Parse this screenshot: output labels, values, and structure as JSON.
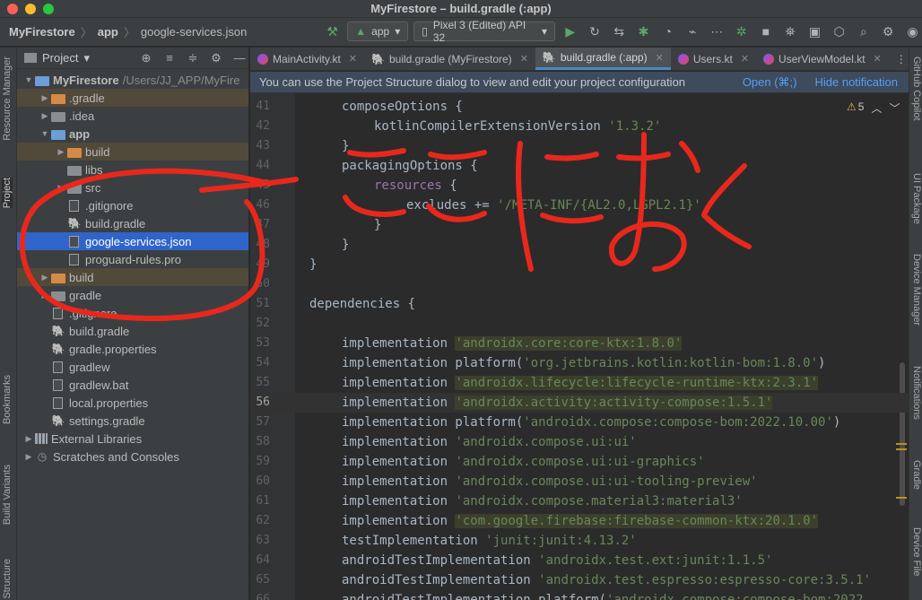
{
  "window": {
    "title": "MyFirestore – build.gradle (:app)"
  },
  "toolbar": {
    "breadcrumb": [
      "MyFirestore",
      "app",
      "google-services.json"
    ],
    "run_config": "app",
    "device": "Pixel 3 (Edited) API 32"
  },
  "left_strip": [
    "Resource Manager",
    "Project",
    "Bookmarks",
    "Build Variants",
    "Structure"
  ],
  "right_strip": [
    "GitHub Copilot",
    "UI Package",
    "Device Manager",
    "Notifications",
    "Gradle",
    "Device File"
  ],
  "project": {
    "header": "Project",
    "tree": [
      {
        "label": "MyFirestore",
        "path": "/Users/JJ_APP/MyFire",
        "level": 0,
        "arrow": "down",
        "icon": "folder-blue",
        "bold": true
      },
      {
        "label": ".gradle",
        "level": 1,
        "arrow": "right",
        "icon": "folder-orange",
        "excluded": true
      },
      {
        "label": ".idea",
        "level": 1,
        "arrow": "right",
        "icon": "folder"
      },
      {
        "label": "app",
        "level": 1,
        "arrow": "down",
        "icon": "folder-blue",
        "bold": true
      },
      {
        "label": "build",
        "level": 2,
        "arrow": "right",
        "icon": "folder-orange",
        "excluded": true
      },
      {
        "label": "libs",
        "level": 2,
        "arrow": "",
        "icon": "folder"
      },
      {
        "label": "src",
        "level": 2,
        "arrow": "right",
        "icon": "folder"
      },
      {
        "label": ".gitignore",
        "level": 2,
        "arrow": "",
        "icon": "file"
      },
      {
        "label": "build.gradle",
        "level": 2,
        "arrow": "",
        "icon": "gradle"
      },
      {
        "label": "google-services.json",
        "level": 2,
        "arrow": "",
        "icon": "file",
        "selected": true
      },
      {
        "label": "proguard-rules.pro",
        "level": 2,
        "arrow": "",
        "icon": "file"
      },
      {
        "label": "build",
        "level": 1,
        "arrow": "right",
        "icon": "folder-orange",
        "excluded": true
      },
      {
        "label": "gradle",
        "level": 1,
        "arrow": "right",
        "icon": "folder"
      },
      {
        "label": ".gitignore",
        "level": 1,
        "arrow": "",
        "icon": "file"
      },
      {
        "label": "build.gradle",
        "level": 1,
        "arrow": "",
        "icon": "gradle"
      },
      {
        "label": "gradle.properties",
        "level": 1,
        "arrow": "",
        "icon": "gradle"
      },
      {
        "label": "gradlew",
        "level": 1,
        "arrow": "",
        "icon": "file"
      },
      {
        "label": "gradlew.bat",
        "level": 1,
        "arrow": "",
        "icon": "file"
      },
      {
        "label": "local.properties",
        "level": 1,
        "arrow": "",
        "icon": "file"
      },
      {
        "label": "settings.gradle",
        "level": 1,
        "arrow": "",
        "icon": "gradle"
      },
      {
        "label": "External Libraries",
        "level": 0,
        "arrow": "right",
        "icon": "library"
      },
      {
        "label": "Scratches and Consoles",
        "level": 0,
        "arrow": "right",
        "icon": "scratch"
      }
    ]
  },
  "tabs": [
    {
      "label": "MainActivity.kt",
      "icon": "kotlin"
    },
    {
      "label": "build.gradle (MyFirestore)",
      "icon": "gradle"
    },
    {
      "label": "build.gradle (:app)",
      "icon": "gradle",
      "active": true
    },
    {
      "label": "Users.kt",
      "icon": "kotlin"
    },
    {
      "label": "UserViewModel.kt",
      "icon": "kotlin"
    }
  ],
  "notification": {
    "text": "You can use the Project Structure dialog to view and edit your project configuration",
    "open_link": "Open (⌘;)",
    "hide_link": "Hide notification"
  },
  "editor": {
    "warnings": "5",
    "current_line": 56,
    "lines": [
      {
        "n": 41,
        "indent": 1,
        "parts": [
          [
            "t",
            "composeOptions {"
          ]
        ]
      },
      {
        "n": 42,
        "indent": 2,
        "parts": [
          [
            "t",
            "kotlinCompilerExtensionVersion "
          ],
          [
            "s",
            "'1.3.2'"
          ]
        ]
      },
      {
        "n": 43,
        "indent": 1,
        "parts": [
          [
            "t",
            "}"
          ]
        ]
      },
      {
        "n": 44,
        "indent": 1,
        "parts": [
          [
            "t",
            "packagingOptions {"
          ]
        ]
      },
      {
        "n": 45,
        "indent": 2,
        "parts": [
          [
            "p",
            "resources"
          ],
          [
            "t",
            " {"
          ]
        ]
      },
      {
        "n": 46,
        "indent": 3,
        "parts": [
          [
            "t",
            "excludes += "
          ],
          [
            "s",
            "'/META-INF/{AL2.0,LGPL2.1}'"
          ]
        ]
      },
      {
        "n": 47,
        "indent": 2,
        "parts": [
          [
            "t",
            "}"
          ]
        ]
      },
      {
        "n": 48,
        "indent": 1,
        "parts": [
          [
            "t",
            "}"
          ]
        ]
      },
      {
        "n": 49,
        "indent": 0,
        "parts": [
          [
            "t",
            "}"
          ]
        ]
      },
      {
        "n": 50,
        "indent": 0,
        "parts": []
      },
      {
        "n": 51,
        "indent": 0,
        "parts": [
          [
            "t",
            "dependencies {"
          ]
        ]
      },
      {
        "n": 52,
        "indent": 0,
        "parts": []
      },
      {
        "n": 53,
        "indent": 1,
        "parts": [
          [
            "t",
            "implementation "
          ],
          [
            "h",
            "'androidx.core:core-ktx:1.8.0'"
          ]
        ]
      },
      {
        "n": 54,
        "indent": 1,
        "parts": [
          [
            "t",
            "implementation platform("
          ],
          [
            "s",
            "'org.jetbrains.kotlin:kotlin-bom:1.8.0'"
          ],
          [
            "t",
            ")"
          ]
        ]
      },
      {
        "n": 55,
        "indent": 1,
        "parts": [
          [
            "t",
            "implementation "
          ],
          [
            "h",
            "'androidx.lifecycle:lifecycle-runtime-ktx:2.3.1'"
          ]
        ]
      },
      {
        "n": 56,
        "indent": 1,
        "parts": [
          [
            "t",
            "implementation "
          ],
          [
            "h",
            "'androidx.activity:activity-compose:1.5.1'"
          ]
        ]
      },
      {
        "n": 57,
        "indent": 1,
        "parts": [
          [
            "t",
            "implementation platform("
          ],
          [
            "s",
            "'androidx.compose:compose-bom:2022.10.00'"
          ],
          [
            "t",
            ")"
          ]
        ]
      },
      {
        "n": 58,
        "indent": 1,
        "parts": [
          [
            "t",
            "implementation "
          ],
          [
            "s",
            "'androidx.compose.ui:ui'"
          ]
        ]
      },
      {
        "n": 59,
        "indent": 1,
        "parts": [
          [
            "t",
            "implementation "
          ],
          [
            "s",
            "'androidx.compose.ui:ui-graphics'"
          ]
        ]
      },
      {
        "n": 60,
        "indent": 1,
        "parts": [
          [
            "t",
            "implementation "
          ],
          [
            "s",
            "'androidx.compose.ui:ui-tooling-preview'"
          ]
        ]
      },
      {
        "n": 61,
        "indent": 1,
        "parts": [
          [
            "t",
            "implementation "
          ],
          [
            "s",
            "'androidx.compose.material3:material3'"
          ]
        ]
      },
      {
        "n": 62,
        "indent": 1,
        "parts": [
          [
            "t",
            "implementation "
          ],
          [
            "h",
            "'com.google.firebase:firebase-common-ktx:20.1.0'"
          ]
        ]
      },
      {
        "n": 63,
        "indent": 1,
        "parts": [
          [
            "t",
            "testImplementation "
          ],
          [
            "s",
            "'junit:junit:4.13.2'"
          ]
        ]
      },
      {
        "n": 64,
        "indent": 1,
        "parts": [
          [
            "t",
            "androidTestImplementation "
          ],
          [
            "s",
            "'androidx.test.ext:junit:1.1.5'"
          ]
        ]
      },
      {
        "n": 65,
        "indent": 1,
        "parts": [
          [
            "t",
            "androidTestImplementation "
          ],
          [
            "s",
            "'androidx.test.espresso:espresso-core:3.5.1'"
          ]
        ]
      },
      {
        "n": 66,
        "indent": 1,
        "parts": [
          [
            "t",
            "androidTestImplementation platform("
          ],
          [
            "s",
            "'androidx.compose:compose-bom:2022"
          ]
        ]
      }
    ]
  },
  "annotation": {
    "color": "#e8281c",
    "handwritten_text": "ここにおく"
  }
}
